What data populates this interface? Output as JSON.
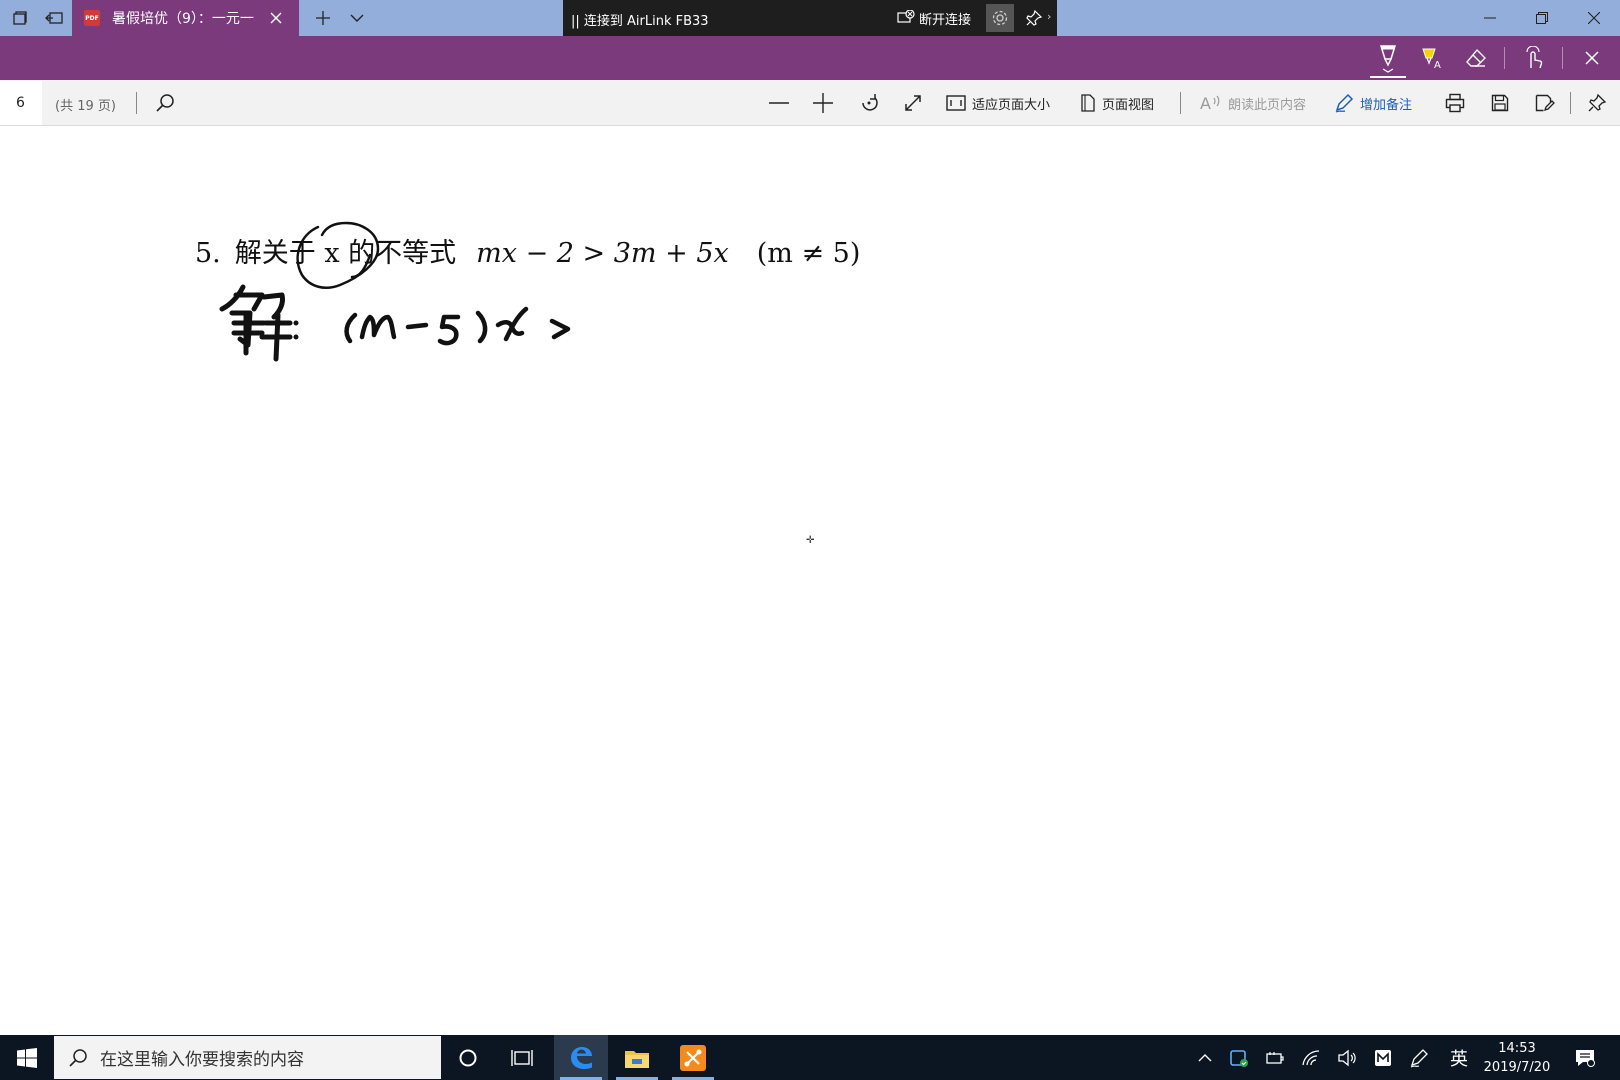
{
  "titlebar": {
    "tab_title": "暑假培优（9）：一元一",
    "pdf_badge": "PDF",
    "cast_title": "|| 连接到 AirLink FB33",
    "cast_disconnect": "断开连接"
  },
  "pdf_toolbar": {
    "page_number": "6",
    "page_total": "(共 19 页)",
    "fit_page": "适应页面大小",
    "page_view": "页面视图",
    "read_aloud": "朗读此页内容",
    "add_note": "增加备注"
  },
  "document": {
    "problem_number": "5.",
    "problem_text": "解关于 x 的不等式",
    "inequality": "mx − 2 > 3m + 5x",
    "condition": "(m ≠ 5)",
    "handwritten_note": "解：(m−5)x >"
  },
  "taskbar": {
    "search_placeholder": "在这里输入你要搜索的内容",
    "ime_label": "英",
    "time": "14:53",
    "date": "2019/7/20"
  },
  "colors": {
    "title_bar": "#93aedb",
    "ink_toolbar": "#7b3a7b",
    "accent_blue": "#1d5fb8",
    "taskbar": "#0b1622"
  }
}
